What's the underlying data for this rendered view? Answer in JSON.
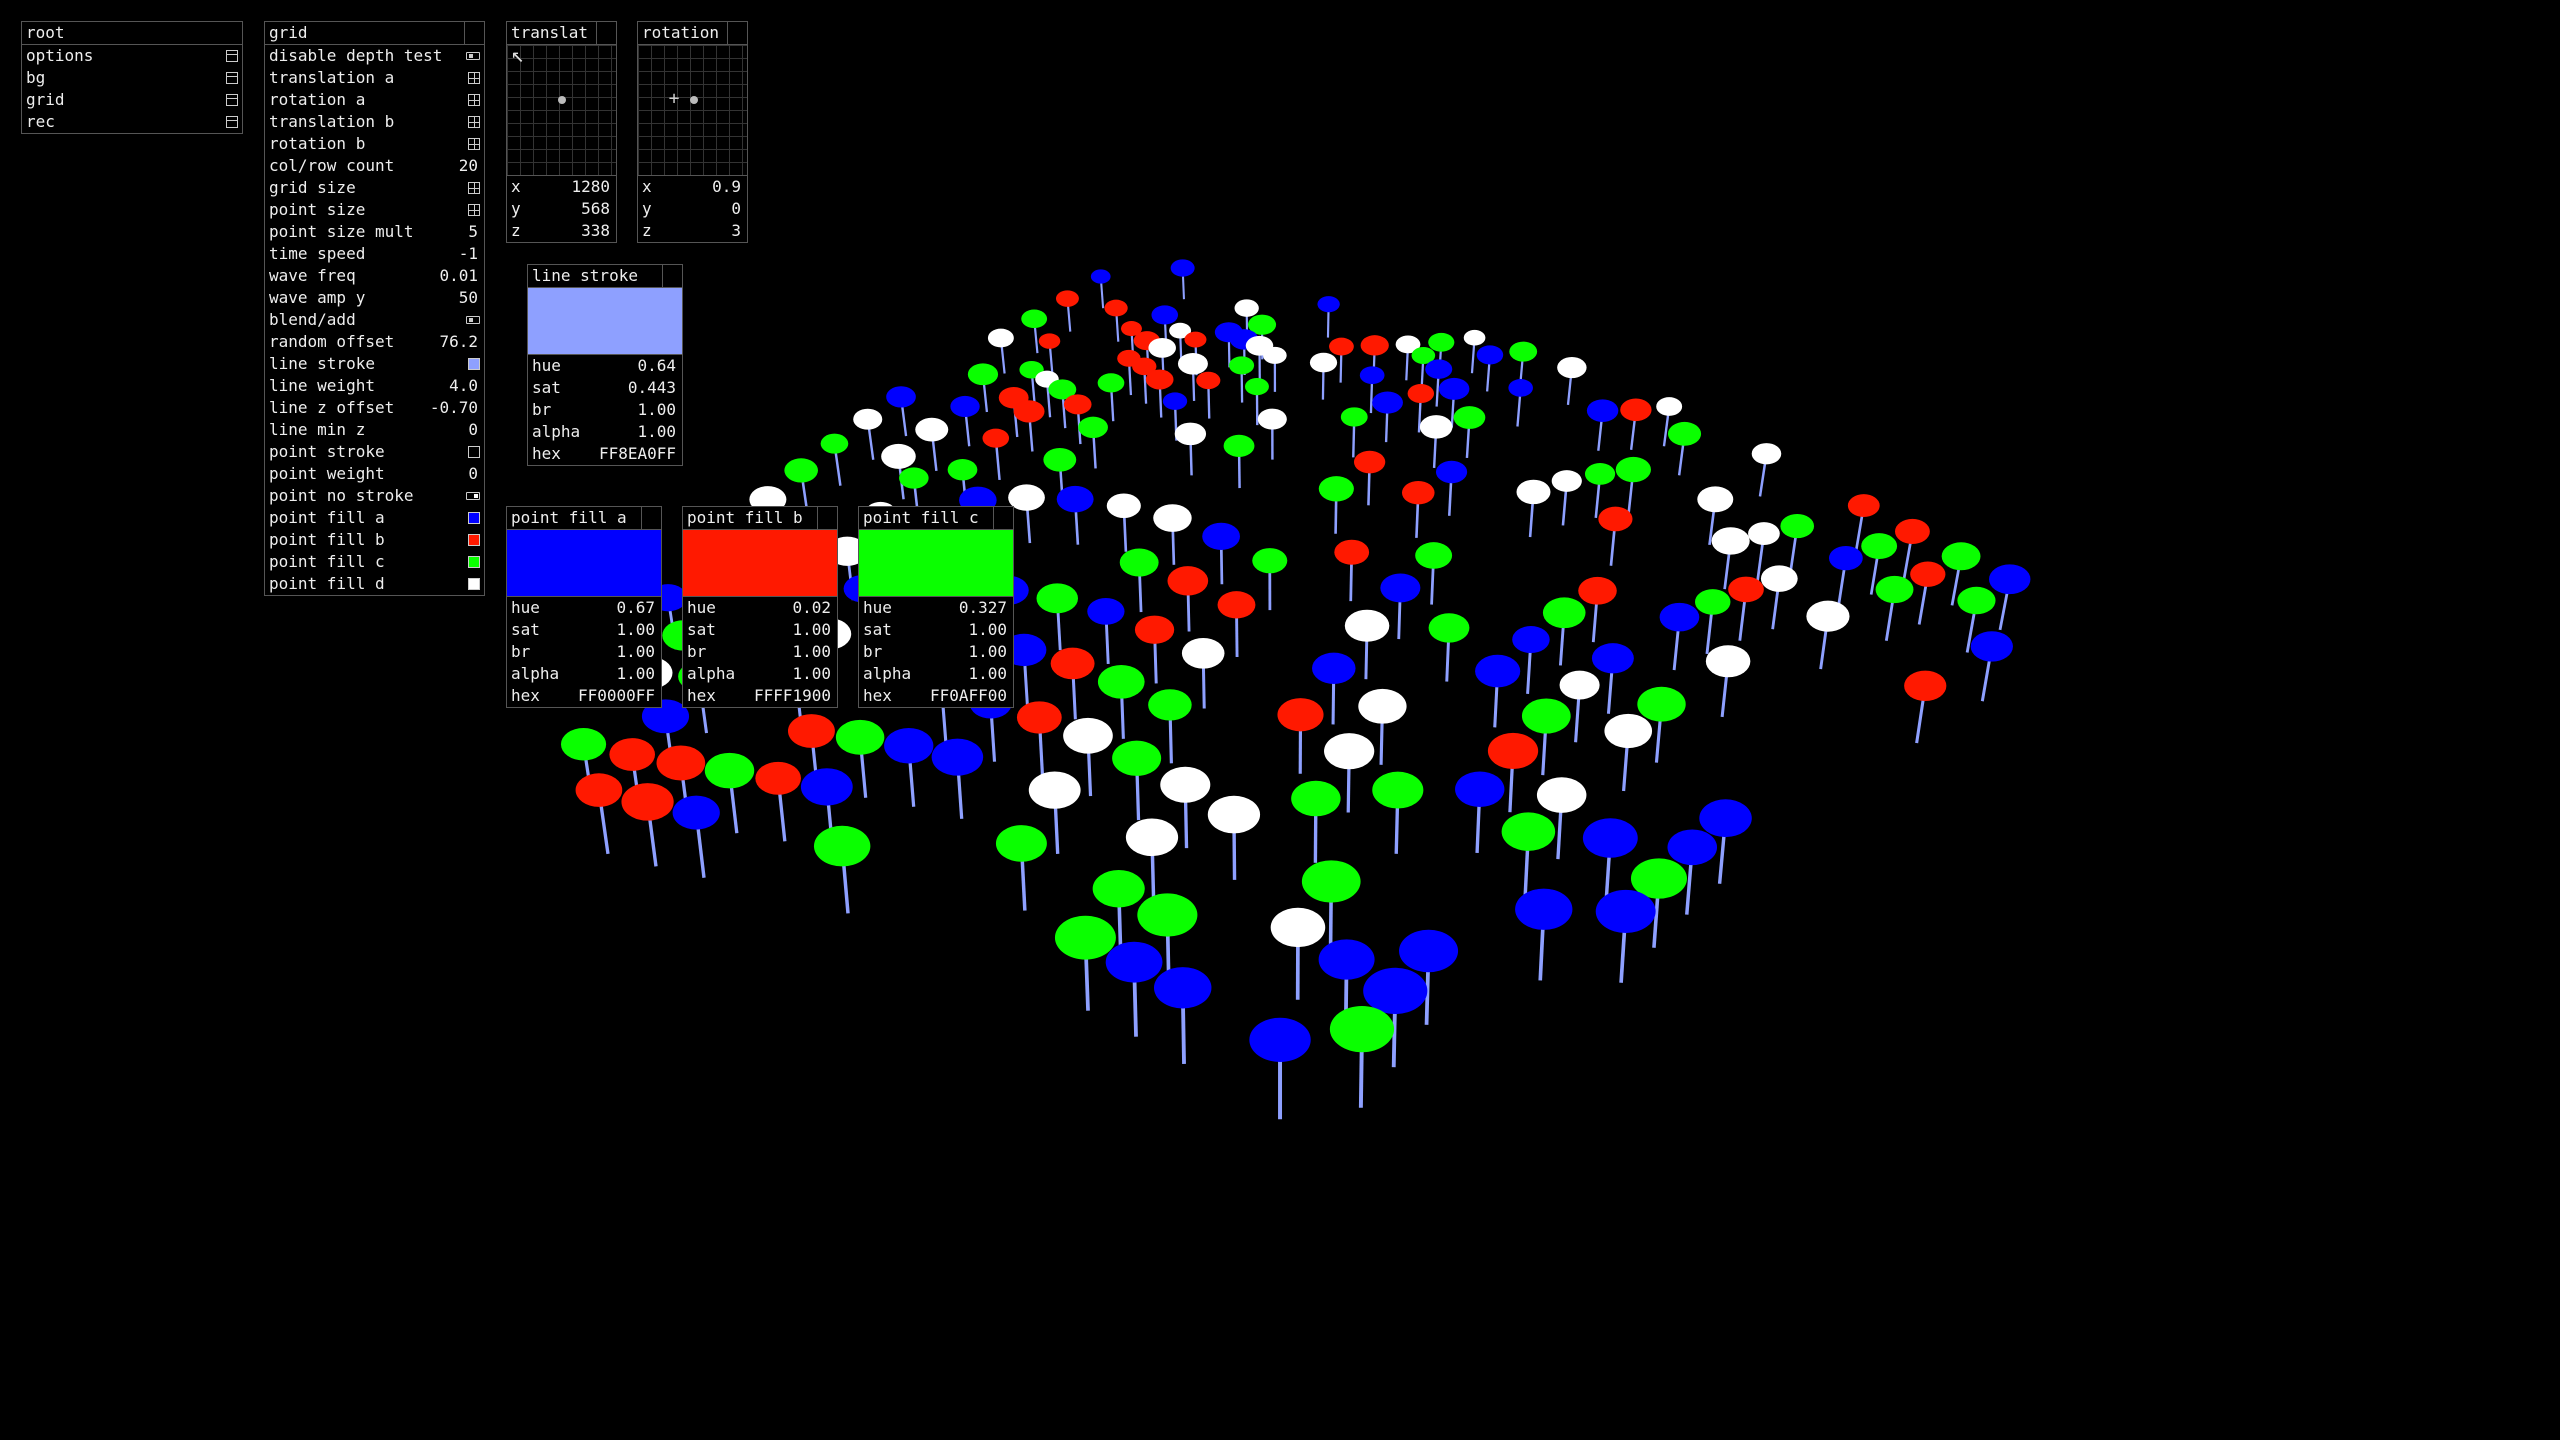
{
  "colors": {
    "line_stroke": "#8EA0FF",
    "fill_a": "#0000FF",
    "fill_b": "#FF1900",
    "fill_c": "#0AFF00",
    "fill_d": "#FFFFFF"
  },
  "root_panel": {
    "title": "root",
    "items": [
      {
        "label": "options",
        "icon": "folder-icon"
      },
      {
        "label": "bg",
        "icon": "folder-icon"
      },
      {
        "label": "grid",
        "icon": "folder-icon"
      },
      {
        "label": "rec",
        "icon": "folder-icon"
      }
    ]
  },
  "grid_panel": {
    "title": "grid",
    "rows": [
      {
        "label": "disable depth test",
        "kind": "toggle-off"
      },
      {
        "label": "translation a",
        "kind": "grid-icon"
      },
      {
        "label": "rotation a",
        "kind": "grid-icon"
      },
      {
        "label": "translation b",
        "kind": "grid-icon"
      },
      {
        "label": "rotation b",
        "kind": "grid-icon"
      },
      {
        "label": "col/row count",
        "value": "20"
      },
      {
        "label": "grid size",
        "kind": "grid-icon"
      },
      {
        "label": "point size",
        "kind": "grid-icon"
      },
      {
        "label": "point size mult",
        "value": "5"
      },
      {
        "label": "time speed",
        "value": "-1"
      },
      {
        "label": "wave freq",
        "value": "0.01"
      },
      {
        "label": "wave amp y",
        "value": "50"
      },
      {
        "label": "blend/add",
        "kind": "toggle-off"
      },
      {
        "label": "random offset",
        "value": "76.2"
      },
      {
        "label": "line stroke",
        "kind": "swatch",
        "color": "#8EA0FF"
      },
      {
        "label": "line weight",
        "value": "4.0"
      },
      {
        "label": "line z offset",
        "value": "-0.70"
      },
      {
        "label": "line min z",
        "value": "0"
      },
      {
        "label": "point stroke",
        "kind": "swatch",
        "color": "#000000"
      },
      {
        "label": "point weight",
        "value": "0"
      },
      {
        "label": "point no stroke",
        "kind": "toggle-on"
      },
      {
        "label": "point fill a",
        "kind": "swatch",
        "color": "#0000FF"
      },
      {
        "label": "point fill b",
        "kind": "swatch",
        "color": "#FF1900"
      },
      {
        "label": "point fill c",
        "kind": "swatch",
        "color": "#0AFF00"
      },
      {
        "label": "point fill d",
        "kind": "swatch",
        "color": "#FFFFFF"
      }
    ]
  },
  "translate_panel": {
    "title": "translat",
    "x": {
      "label": "x",
      "value": "1280"
    },
    "y": {
      "label": "y",
      "value": "568"
    },
    "z": {
      "label": "z",
      "value": "338"
    }
  },
  "rotation_panel": {
    "title": "rotation",
    "x": {
      "label": "x",
      "value": "0.9"
    },
    "y": {
      "label": "y",
      "value": "0"
    },
    "z": {
      "label": "z",
      "value": "3"
    }
  },
  "line_stroke_panel": {
    "title": "line stroke",
    "color": "#8EA0FF",
    "hue": {
      "label": "hue",
      "value": "0.64"
    },
    "sat": {
      "label": "sat",
      "value": "0.443"
    },
    "br": {
      "label": "br",
      "value": "1.00"
    },
    "alpha": {
      "label": "alpha",
      "value": "1.00"
    },
    "hex": {
      "label": "hex",
      "value": "FF8EA0FF"
    }
  },
  "fill_a_panel": {
    "title": "point fill a",
    "color": "#0000FF",
    "hue": {
      "label": "hue",
      "value": "0.67"
    },
    "sat": {
      "label": "sat",
      "value": "1.00"
    },
    "br": {
      "label": "br",
      "value": "1.00"
    },
    "alpha": {
      "label": "alpha",
      "value": "1.00"
    },
    "hex": {
      "label": "hex",
      "value": "FF0000FF"
    }
  },
  "fill_b_panel": {
    "title": "point fill b",
    "color": "#FF1900",
    "hue": {
      "label": "hue",
      "value": "0.02"
    },
    "sat": {
      "label": "sat",
      "value": "1.00"
    },
    "br": {
      "label": "br",
      "value": "1.00"
    },
    "alpha": {
      "label": "alpha",
      "value": "1.00"
    },
    "hex": {
      "label": "hex",
      "value": "FFFF1900"
    }
  },
  "fill_c_panel": {
    "title": "point fill c",
    "color": "#0AFF00",
    "hue": {
      "label": "hue",
      "value": "0.327"
    },
    "sat": {
      "label": "sat",
      "value": "1.00"
    },
    "br": {
      "label": "br",
      "value": "1.00"
    },
    "alpha": {
      "label": "alpha",
      "value": "1.00"
    },
    "hex": {
      "label": "hex",
      "value": "FF0AFF00"
    }
  }
}
